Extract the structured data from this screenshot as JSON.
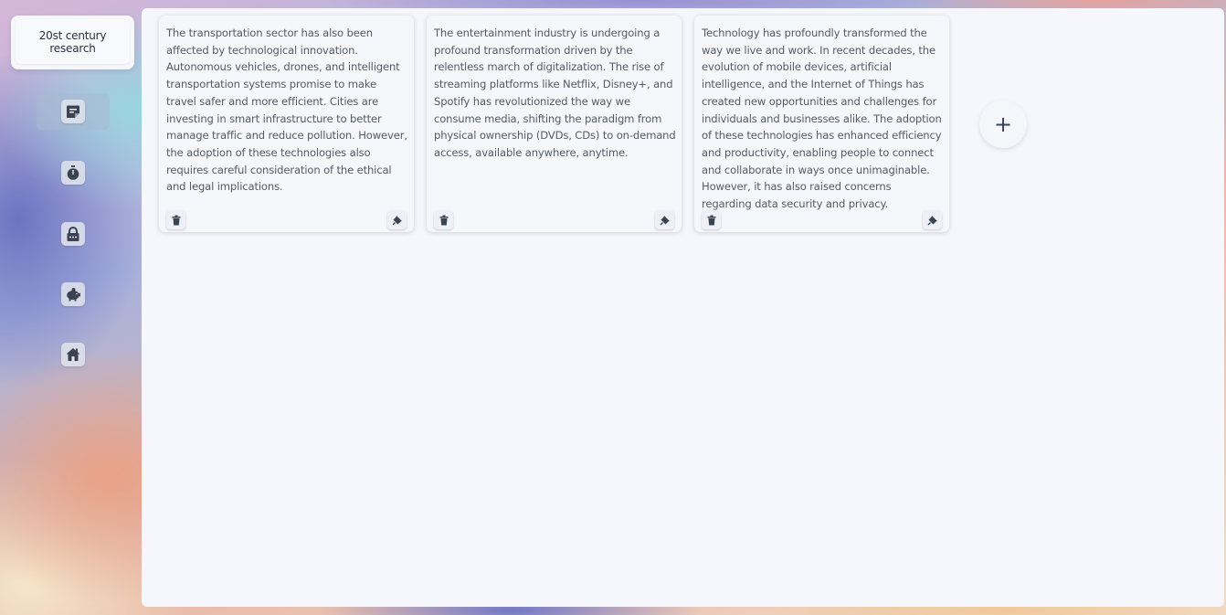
{
  "notebook": {
    "title": "20st century research"
  },
  "sidebar": {
    "items": [
      {
        "icon": "note-icon",
        "active": true
      },
      {
        "icon": "stopwatch-icon",
        "active": false
      },
      {
        "icon": "lock-icon",
        "active": false
      },
      {
        "icon": "piggy-bank-icon",
        "active": false
      },
      {
        "icon": "home-icon",
        "active": false
      }
    ]
  },
  "notes": [
    {
      "text": "The transportation sector has also been affected by technological innovation. Autonomous vehicles, drones, and intelligent transportation systems promise to make travel safer and more efficient. Cities are investing in smart infrastructure to better manage traffic and reduce pollution. However, the adoption of these technologies also requires careful consideration of the ethical and legal implications."
    },
    {
      "text": "The entertainment industry is undergoing a profound transformation driven by the relentless march of digitalization. The rise of streaming platforms like Netflix, Disney+, and Spotify has revolutionized the way we consume media, shifting the paradigm from physical ownership (DVDs, CDs) to on-demand access, available anywhere, anytime."
    },
    {
      "text": "Technology has profoundly transformed the way we live and work. In recent decades, the evolution of mobile devices, artificial intelligence, and the Internet of Things has created new opportunities and challenges for individuals and businesses alike. The adoption of these technologies has enhanced efficiency and productivity, enabling people to connect and collaborate in ways once unimaginable. However, it has also raised concerns regarding data security and privacy."
    }
  ],
  "actions": {
    "add_label": "+"
  },
  "colors": {
    "panel": "#f6f7fc",
    "icon": "#3b4251",
    "text": "#555b66"
  }
}
